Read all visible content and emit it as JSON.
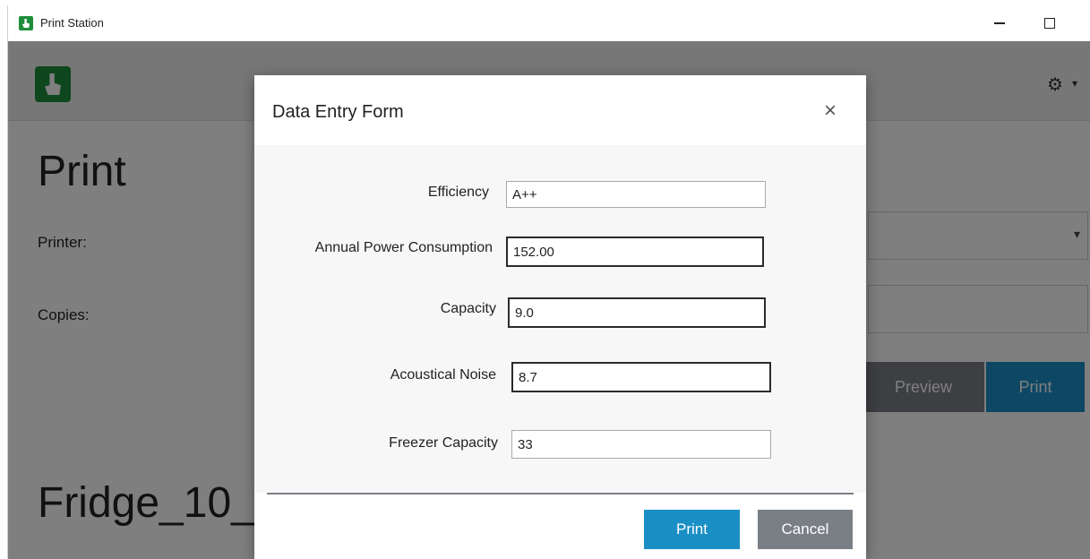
{
  "window": {
    "title": "Print Station",
    "minimize_label": "minimize",
    "maximize_label": "maximize"
  },
  "page": {
    "heading": "Print",
    "printer_label": "Printer:",
    "copies_label": "Copies:",
    "preview_label": "Preview",
    "print_label": "Print",
    "file_name": "Fridge_10_C"
  },
  "modal": {
    "title": "Data Entry Form",
    "close_glyph": "×",
    "fields": [
      {
        "label": "Efficiency",
        "value": "A++"
      },
      {
        "label": "Annual Power Consumption",
        "value": "152.00"
      },
      {
        "label": "Capacity",
        "value": "9.0"
      },
      {
        "label": "Acoustical Noise",
        "value": "8.7"
      },
      {
        "label": "Freezer Capacity",
        "value": "33"
      }
    ],
    "print_button": "Print",
    "cancel_button": "Cancel"
  },
  "icons": {
    "gear": "⚙",
    "caret": "▾"
  },
  "colors": {
    "accent": "#1a8fc6",
    "secondary_button": "#7a7f86",
    "brand_green": "#1d8f3a"
  }
}
